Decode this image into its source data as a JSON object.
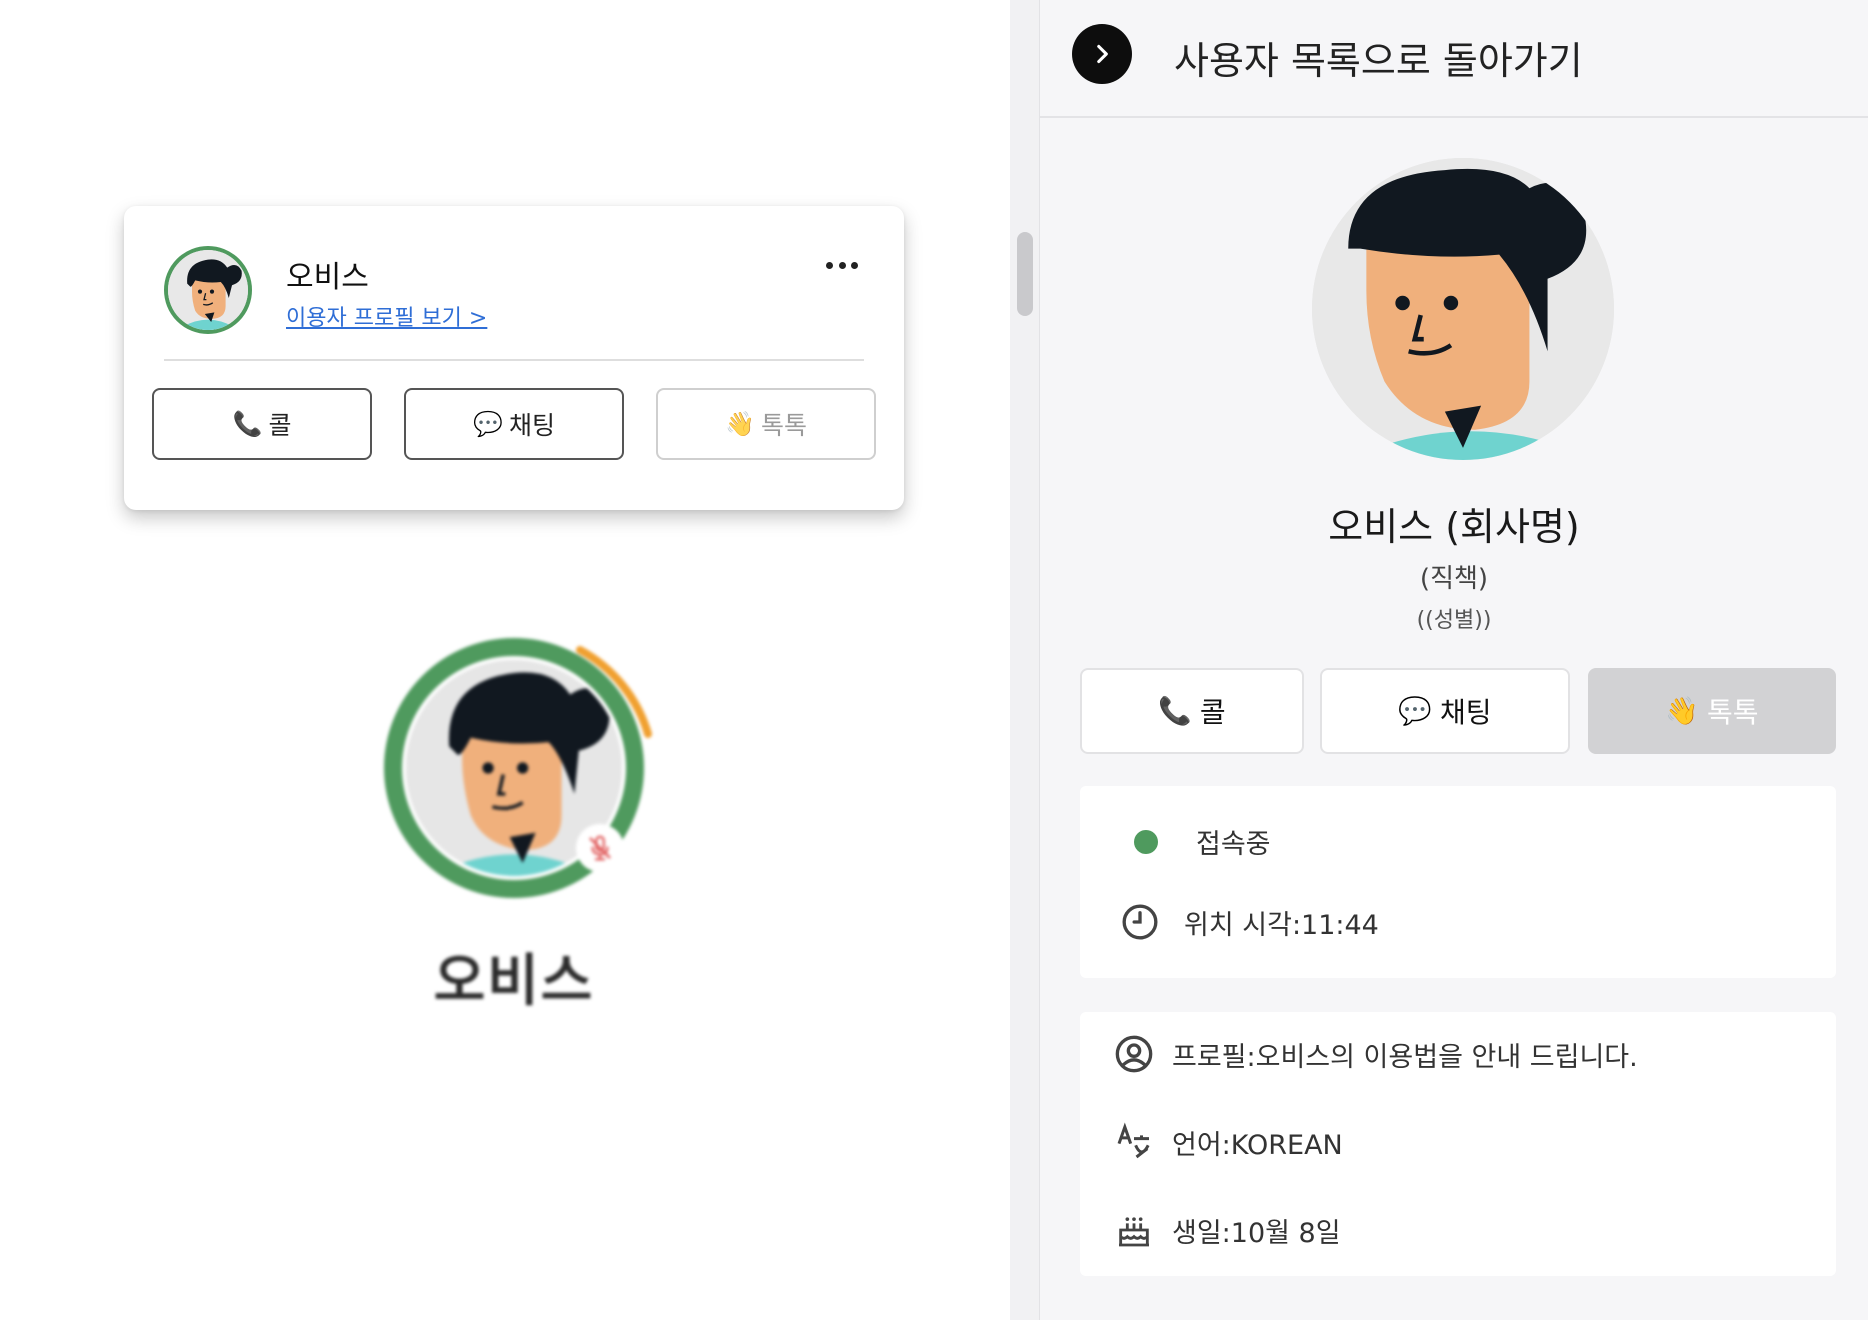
{
  "popup": {
    "name": "오비스",
    "profile_link": "이용자 프로필 보기 >",
    "buttons": [
      {
        "label": "콜",
        "icon": "📞",
        "icon_name": "phone-icon"
      },
      {
        "label": "채팅",
        "icon": "💬",
        "icon_name": "chat-bubble-icon"
      },
      {
        "label": "톡톡",
        "icon": "👋",
        "icon_name": "waving-hand-icon"
      }
    ]
  },
  "avatar_tile": {
    "name": "오비스",
    "ring_color": "#4f9a5e",
    "arc_color": "#f0a030",
    "mic_status": "muted"
  },
  "panel": {
    "header_title": "사용자 목록으로 돌아가기",
    "name": "오비스 (회사명)",
    "role": "(직책)",
    "gender": "((성별))",
    "buttons": [
      {
        "label": "콜",
        "icon": "📞",
        "icon_name": "phone-icon"
      },
      {
        "label": "채팅",
        "icon": "💬",
        "icon_name": "chat-bubble-icon"
      },
      {
        "label": "톡톡",
        "icon": "👋",
        "icon_name": "waving-hand-icon"
      }
    ],
    "status": {
      "text": "접속중",
      "dot_color": "#4f9a5e",
      "location_time": "위치 시각:11:44"
    },
    "details": {
      "profile": "프로필:오비스의 이용법을 안내 드립니다.",
      "language": "언어:KOREAN",
      "birthday": "생일:10월 8일"
    }
  },
  "colors": {
    "accent_green": "#4f9a5e",
    "link_blue": "#2f6ed6",
    "panel_bg": "#f6f6f8",
    "skin": "#f0b07c",
    "hair": "#111820",
    "shirt": "#6fd3cf"
  }
}
